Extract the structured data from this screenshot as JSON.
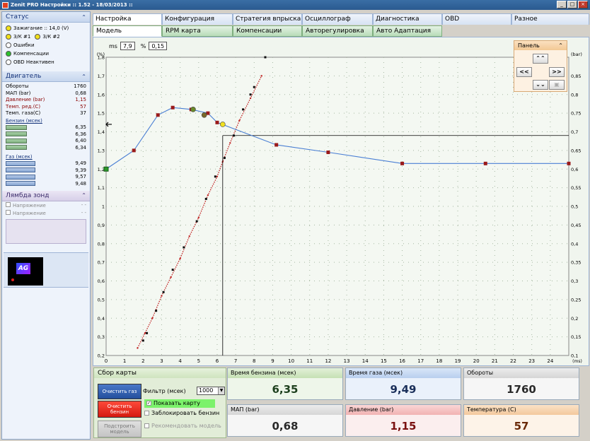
{
  "window": {
    "title": "Zenit PRO Настройки :: 1.52 - 18/03/2013 ::"
  },
  "status": {
    "title": "Статус",
    "ignition": "Зажигание :: 14,0 (V)",
    "valve1": "З/К #1",
    "valve2": "З/К #2",
    "errors": "Ошибки",
    "compensation": "Компенсации",
    "obd": "OBD Неактивен"
  },
  "engine": {
    "title": "Двигатель",
    "rows": [
      {
        "label": "Обороты",
        "value": "1760",
        "red": false
      },
      {
        "label": "МАП (bar)",
        "value": "0,68",
        "red": false
      },
      {
        "label": "Давление (bar)",
        "value": "1,15",
        "red": true
      },
      {
        "label": "Темп. ред.(C)",
        "value": "57",
        "red": true
      },
      {
        "label": "Темп. газа(C)",
        "value": "37",
        "red": false
      }
    ],
    "petrol_label": "Бензин (мсек)",
    "petrol_values": [
      "6,35",
      "6,36",
      "6,40",
      "6,34"
    ],
    "gas_label": "Газ (мсек)",
    "gas_values": [
      "9,49",
      "9,39",
      "9,57",
      "9,48"
    ]
  },
  "lambda": {
    "title": "Лямбда зонд",
    "rows": [
      {
        "label": "Напряжение",
        "value": "- -"
      },
      {
        "label": "Напряжение",
        "value": "- -"
      }
    ]
  },
  "tabs": [
    "Настройка",
    "Конфигурация",
    "Стратегия впрыска",
    "Осциллограф",
    "Диагностика",
    "OBD",
    "Разное"
  ],
  "subtabs": [
    "Модель",
    "RPM карта",
    "Компенсации",
    "Авторегулировка",
    "Авто Адаптация"
  ],
  "readout": {
    "ms_label": "ms",
    "ms_value": "7,9",
    "pct_label": "%",
    "pct_value": "0,15"
  },
  "panel": {
    "title": "Панель",
    "up": "⌃⌃",
    "left": "<<",
    "right": ">>",
    "down": "⌄⌄"
  },
  "chart_data": {
    "type": "scatter",
    "left_axis_label": "(%)",
    "right_axis_label": "(bar)",
    "x_unit_label": "(ms)",
    "x_ticks": [
      "0",
      "1",
      "2",
      "3",
      "4",
      "5",
      "6",
      "7",
      "8",
      "9",
      "10",
      "11",
      "12",
      "13",
      "14",
      "15",
      "16",
      "17",
      "18",
      "19",
      "20",
      "21",
      "22",
      "23",
      "24"
    ],
    "left_ticks": [
      "0,2",
      "0,3",
      "0,4",
      "0,5",
      "0,6",
      "0,7",
      "0,8",
      "0,9",
      "1",
      "1,1",
      "1,2",
      "1,3",
      "1,4",
      "1,5",
      "1,6",
      "1,7",
      "1,8"
    ],
    "right_ticks": [
      "0,1",
      "0,15",
      "0,2",
      "0,25",
      "0,3",
      "0,35",
      "0,4",
      "0,45",
      "0,5",
      "0,55",
      "0,6",
      "0,65",
      "0,7",
      "0,75",
      "0,8",
      "0,85"
    ],
    "xlim": [
      0,
      25
    ],
    "ylim_left": [
      0.2,
      1.8
    ],
    "ylim_right": [
      0.1,
      0.9
    ],
    "grid": true,
    "series": [
      {
        "kind": "correction_curve",
        "axis": "left",
        "color": "#4a7fd4",
        "marker_color": "#9a1a1a",
        "points": [
          [
            0,
            1.2
          ],
          [
            1.5,
            1.3
          ],
          [
            2.8,
            1.49
          ],
          [
            3.6,
            1.53
          ],
          [
            4.6,
            1.52
          ],
          [
            5.5,
            1.5
          ],
          [
            6,
            1.45
          ],
          [
            9.2,
            1.33
          ],
          [
            12,
            1.29
          ],
          [
            16,
            1.23
          ],
          [
            20.5,
            1.23
          ],
          [
            25,
            1.23
          ]
        ],
        "highlight_points": [
          [
            0,
            1.2
          ],
          [
            4.7,
            1.52
          ],
          [
            5.3,
            1.49
          ],
          [
            6.3,
            1.44
          ]
        ]
      },
      {
        "kind": "petrol_gas_samples",
        "axis": "right",
        "color": "#c02020",
        "points": [
          [
            1.7,
            0.12
          ],
          [
            2.1,
            0.16
          ],
          [
            2.5,
            0.2
          ],
          [
            3,
            0.26
          ],
          [
            3.5,
            0.31
          ],
          [
            4,
            0.36
          ],
          [
            4.5,
            0.42
          ],
          [
            5,
            0.47
          ],
          [
            5.5,
            0.53
          ],
          [
            6,
            0.58
          ],
          [
            6.3,
            0.62
          ],
          [
            6.7,
            0.67
          ],
          [
            7.2,
            0.73
          ],
          [
            7.8,
            0.79
          ],
          [
            8.4,
            0.85
          ]
        ]
      },
      {
        "kind": "petrol_gas_points",
        "axis": "right",
        "color": "#101010",
        "points": [
          [
            1.1,
            0.05
          ],
          [
            1.4,
            0.05
          ],
          [
            2,
            0.14
          ],
          [
            2.2,
            0.16
          ],
          [
            2.7,
            0.22
          ],
          [
            3.1,
            0.27
          ],
          [
            3.6,
            0.33
          ],
          [
            4.2,
            0.39
          ],
          [
            4.9,
            0.46
          ],
          [
            5.4,
            0.52
          ],
          [
            5.9,
            0.58
          ],
          [
            6.4,
            0.63
          ],
          [
            6.9,
            0.69
          ],
          [
            7.4,
            0.76
          ],
          [
            7.8,
            0.8
          ],
          [
            8,
            0.82
          ],
          [
            8.6,
            0.9
          ]
        ]
      }
    ],
    "cursor": {
      "x": 6.3,
      "y_right": 0.69
    }
  },
  "collect": {
    "title": "Сбор карты",
    "btn_clear_gas": "Очистить газ",
    "btn_clear_petrol": "Очистить бензин",
    "btn_build_model": "Подстроить модель",
    "filter_label": "Фильтр (мсек)",
    "filter_value": "1000",
    "opt_show_map": "Показать карту",
    "opt_lock_petrol": "Заблокировать бензин",
    "opt_recommend": "Рекомендовать модель"
  },
  "cards": {
    "petrol_time": {
      "label": "Время бензина (мсек)",
      "value": "6,35"
    },
    "gas_time": {
      "label": "Время газа (мсек)",
      "value": "9,49"
    },
    "rpm": {
      "label": "Обороты",
      "value": "1760"
    },
    "map": {
      "label": "МАП (bar)",
      "value": "0,68"
    },
    "pressure": {
      "label": "Давление (bar)",
      "value": "1,15"
    },
    "temp": {
      "label": "Температура (C)",
      "value": "57"
    }
  }
}
